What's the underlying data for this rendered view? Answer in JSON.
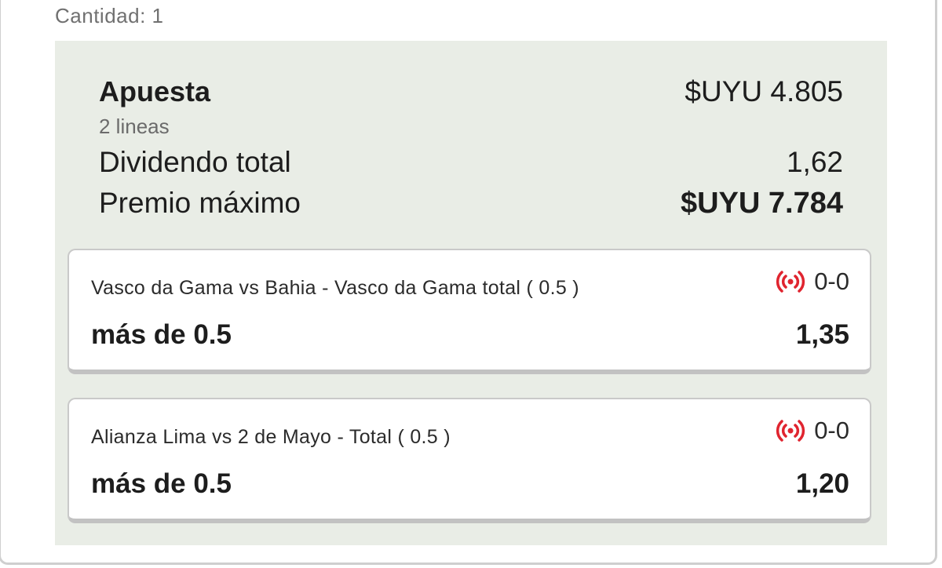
{
  "header": {
    "quantity_label": "Cantidad: 1"
  },
  "summary": {
    "bet_label": "Apuesta",
    "bet_amount": "$UYU 4.805",
    "lines_label": "2 lineas",
    "total_dividend_label": "Dividendo total",
    "total_dividend_value": "1,62",
    "max_prize_label": "Premio máximo",
    "max_prize_value": "$UYU 7.784"
  },
  "selections": [
    {
      "event": "Vasco da Gama vs Bahia - Vasco da Gama total ( 0.5 )",
      "score": "0-0",
      "market": "más de 0.5",
      "odds": "1,35",
      "live_icon": "live-broadcast-icon"
    },
    {
      "event": "Alianza Lima vs 2 de Mayo - Total ( 0.5 )",
      "score": "0-0",
      "market": "más de 0.5",
      "odds": "1,20",
      "live_icon": "live-broadcast-icon"
    }
  ],
  "colors": {
    "panel_background": "#e9ede6",
    "live_red": "#e0242f",
    "text_dark": "#1d1d1d",
    "text_muted": "#6b6b6b"
  }
}
